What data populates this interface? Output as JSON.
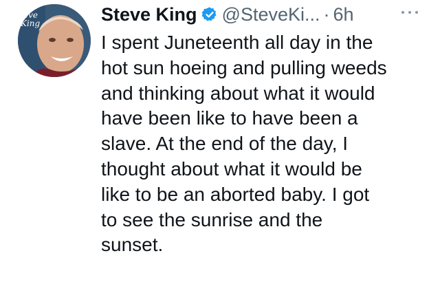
{
  "tweet": {
    "author": {
      "name": "Steve King",
      "handle": "@SteveKi...",
      "avatar_text": [
        "eve",
        "King"
      ],
      "verified": true
    },
    "separator": "·",
    "timestamp": "6h",
    "more_icon": "more-horizontal-icon",
    "body_lines": [
      "I spent Juneteenth all day in the",
      "hot sun hoeing and pulling weeds",
      "and thinking about what it would",
      "have been like to have been a",
      "slave. At the end of the day, I",
      "thought about what it would be",
      "like to be an aborted baby. I got",
      "to see the sunrise and the",
      "sunset."
    ]
  },
  "colors": {
    "text": "#0f1419",
    "secondary": "#536471",
    "verified": "#1d9bf0"
  }
}
